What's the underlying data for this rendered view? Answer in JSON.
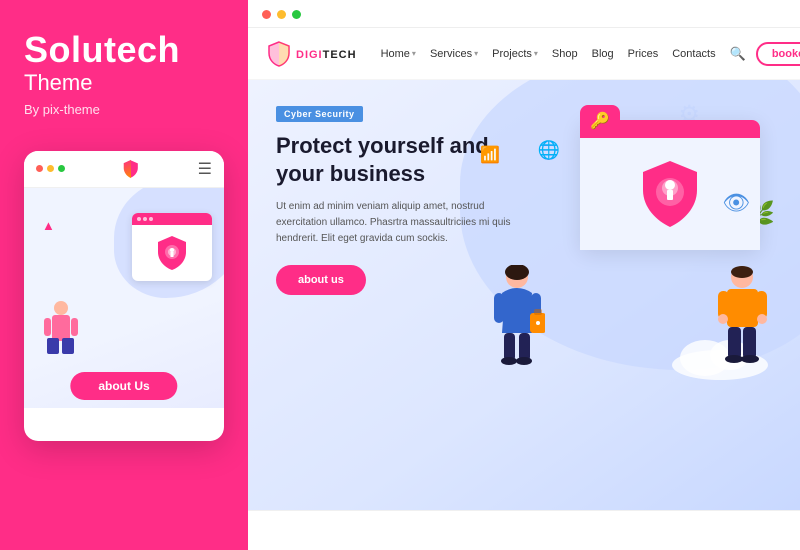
{
  "left": {
    "brand_title": "Solutech",
    "brand_subtitle": "Theme",
    "brand_by": "By pix-theme",
    "mobile": {
      "about_btn_label": "about Us",
      "dots": [
        "#ff5f57",
        "#febc2e",
        "#28c840"
      ]
    }
  },
  "right": {
    "browser": {
      "dots": [
        "#ff5f57",
        "#febc2e",
        "#28c840"
      ]
    },
    "nav": {
      "logo_digi": "DIGI",
      "logo_tech": "TECH",
      "links": [
        "Home",
        "Services",
        "Projects",
        "Shop",
        "Blog",
        "Prices",
        "Contacts"
      ],
      "booked_label": "booked"
    },
    "hero": {
      "badge": "Cyber Security",
      "title": "Protect yourself and your business",
      "description": "Ut enim ad minim veniam aliquip amet, nostrud exercitation ullamco. Phasrtra massaultriciies mi quis hendrerit. Elit eget gravida cum sockis.",
      "about_btn_label": "about us"
    }
  }
}
